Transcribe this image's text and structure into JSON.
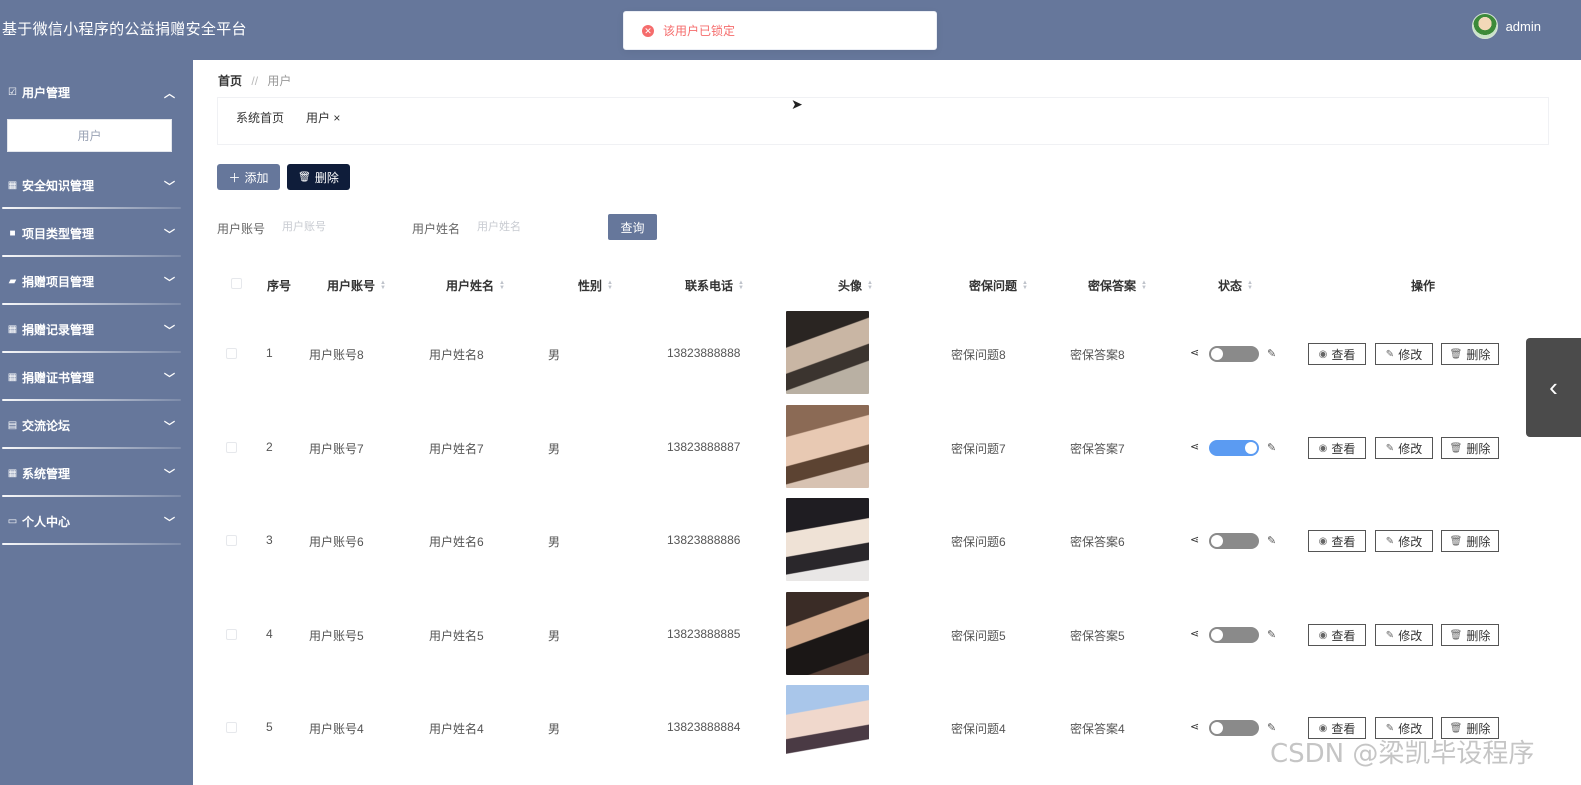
{
  "app": {
    "title": "基于微信小程序的公益捐赠安全平台",
    "username": "admin"
  },
  "toast": {
    "message": "该用户已锁定"
  },
  "sidebar": {
    "items": [
      {
        "label": "用户管理",
        "icon": "checkbox-icon",
        "open": true,
        "sub": [
          "用户"
        ]
      },
      {
        "label": "安全知识管理",
        "icon": "grid-icon"
      },
      {
        "label": "项目类型管理",
        "icon": "briefcase-icon"
      },
      {
        "label": "捐赠项目管理",
        "icon": "hand-icon"
      },
      {
        "label": "捐赠记录管理",
        "icon": "grid-icon"
      },
      {
        "label": "捐赠证书管理",
        "icon": "grid-icon"
      },
      {
        "label": "交流论坛",
        "icon": "clipboard-icon"
      },
      {
        "label": "系统管理",
        "icon": "grid-icon"
      },
      {
        "label": "个人中心",
        "icon": "card-icon"
      }
    ]
  },
  "breadcrumb": {
    "home": "首页",
    "sep": "//",
    "current": "用户"
  },
  "tags": {
    "home": "系统首页",
    "current": "用户 ×"
  },
  "toolbar": {
    "add_label": "添加",
    "delete_label": "删除"
  },
  "search": {
    "account_label": "用户账号",
    "account_placeholder": "用户账号",
    "name_label": "用户姓名",
    "name_placeholder": "用户姓名",
    "query_label": "查询"
  },
  "table": {
    "headers": [
      "序号",
      "用户账号",
      "用户姓名",
      "性别",
      "联系电话",
      "头像",
      "密保问题",
      "密保答案",
      "状态",
      "操作"
    ],
    "rows": [
      {
        "no": "1",
        "account": "用户账号8",
        "name": "用户姓名8",
        "gender": "男",
        "phone": "13823888888",
        "question": "密保问题8",
        "answer": "密保答案8",
        "status_on": false
      },
      {
        "no": "2",
        "account": "用户账号7",
        "name": "用户姓名7",
        "gender": "男",
        "phone": "13823888887",
        "question": "密保问题7",
        "answer": "密保答案7",
        "status_on": true
      },
      {
        "no": "3",
        "account": "用户账号6",
        "name": "用户姓名6",
        "gender": "男",
        "phone": "13823888886",
        "question": "密保问题6",
        "answer": "密保答案6",
        "status_on": false
      },
      {
        "no": "4",
        "account": "用户账号5",
        "name": "用户姓名5",
        "gender": "男",
        "phone": "13823888885",
        "question": "密保问题5",
        "answer": "密保答案5",
        "status_on": false
      },
      {
        "no": "5",
        "account": "用户账号4",
        "name": "用户姓名4",
        "gender": "男",
        "phone": "13823888884",
        "question": "密保问题4",
        "answer": "密保答案4",
        "status_on": false
      }
    ],
    "actions": {
      "view": "查看",
      "edit": "修改",
      "delete": "删除"
    }
  },
  "watermark": "CSDN @梁凯毕设程序",
  "colors": {
    "primary": "#66779b",
    "danger": "#f56c6c",
    "dark": "#0f1d3a",
    "switch_on": "#5b9bf2"
  }
}
